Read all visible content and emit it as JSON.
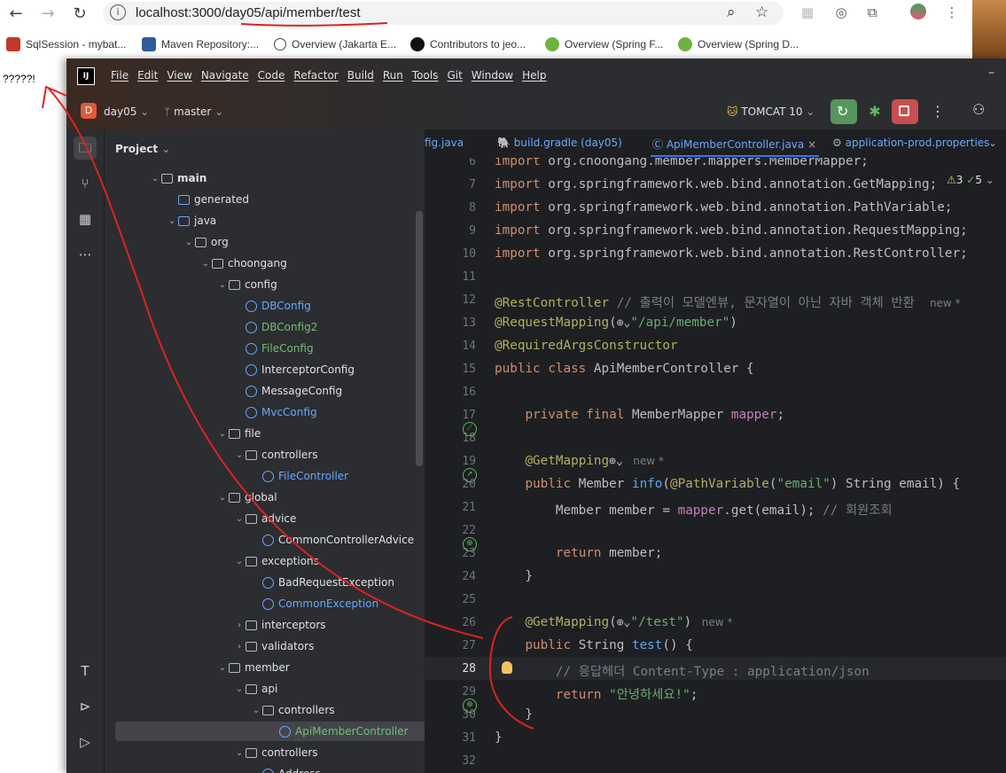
{
  "browser": {
    "url": "localhost:3000/day05/api/member/test",
    "bookmarks": [
      {
        "label": "SqlSession - mybat...",
        "color": "#c0392b"
      },
      {
        "label": "Maven Repository:...",
        "color": "#2e5d9a"
      },
      {
        "label": "Overview (Jakarta E...",
        "color": "#444444"
      },
      {
        "label": "Contributors to jeo...",
        "color": "#111111"
      },
      {
        "label": "Overview (Spring F...",
        "color": "#6db33f"
      },
      {
        "label": "Overview (Spring D...",
        "color": "#6db33f"
      }
    ],
    "page_text": "?????!"
  },
  "ide": {
    "logo": "IJ",
    "menu": [
      "File",
      "Edit",
      "View",
      "Navigate",
      "Code",
      "Refactor",
      "Build",
      "Run",
      "Tools",
      "Git",
      "Window",
      "Help"
    ],
    "project_badge": "D",
    "project_name": "day05",
    "branch": "master",
    "run_config": "TOMCAT 10",
    "project_panel_title": "Project",
    "tabs": [
      "fig.java",
      "build.gradle (day05)",
      "ApiMemberController.java",
      "application-prod.properties"
    ],
    "inspections": {
      "warnings": "3",
      "ok": "5"
    }
  },
  "tree": [
    {
      "label": "main",
      "indent": 0,
      "arrow": "v",
      "icon": "folder",
      "bold": true
    },
    {
      "label": "generated",
      "indent": 1,
      "arrow": "",
      "icon": "folder-blue"
    },
    {
      "label": "java",
      "indent": 1,
      "arrow": "v",
      "icon": "folder-blue"
    },
    {
      "label": "org",
      "indent": 2,
      "arrow": "v",
      "icon": "folder"
    },
    {
      "label": "choongang",
      "indent": 3,
      "arrow": "v",
      "icon": "folder"
    },
    {
      "label": "config",
      "indent": 4,
      "arrow": "v",
      "icon": "folder"
    },
    {
      "label": "DBConfig",
      "indent": 5,
      "arrow": "",
      "icon": "class",
      "color": "blue"
    },
    {
      "label": "DBConfig2",
      "indent": 5,
      "arrow": "",
      "icon": "class",
      "color": "green"
    },
    {
      "label": "FileConfig",
      "indent": 5,
      "arrow": "",
      "icon": "class",
      "color": "green"
    },
    {
      "label": "InterceptorConfig",
      "indent": 5,
      "arrow": "",
      "icon": "class"
    },
    {
      "label": "MessageConfig",
      "indent": 5,
      "arrow": "",
      "icon": "class"
    },
    {
      "label": "MvcConfig",
      "indent": 5,
      "arrow": "",
      "icon": "class",
      "color": "blue"
    },
    {
      "label": "file",
      "indent": 4,
      "arrow": "v",
      "icon": "folder"
    },
    {
      "label": "controllers",
      "indent": 5,
      "arrow": "v",
      "icon": "folder"
    },
    {
      "label": "FileController",
      "indent": 6,
      "arrow": "",
      "icon": "class",
      "color": "blue"
    },
    {
      "label": "global",
      "indent": 4,
      "arrow": "v",
      "icon": "folder"
    },
    {
      "label": "advice",
      "indent": 5,
      "arrow": "v",
      "icon": "folder"
    },
    {
      "label": "CommonControllerAdvice",
      "indent": 6,
      "arrow": "",
      "icon": "class"
    },
    {
      "label": "exceptions",
      "indent": 5,
      "arrow": "v",
      "icon": "folder"
    },
    {
      "label": "BadRequestException",
      "indent": 6,
      "arrow": "",
      "icon": "exception"
    },
    {
      "label": "CommonException",
      "indent": 6,
      "arrow": "",
      "icon": "exception",
      "color": "blue"
    },
    {
      "label": "interceptors",
      "indent": 5,
      "arrow": ">",
      "icon": "folder"
    },
    {
      "label": "validators",
      "indent": 5,
      "arrow": ">",
      "icon": "folder"
    },
    {
      "label": "member",
      "indent": 4,
      "arrow": "v",
      "icon": "folder"
    },
    {
      "label": "api",
      "indent": 5,
      "arrow": "v",
      "icon": "folder"
    },
    {
      "label": "controllers",
      "indent": 6,
      "arrow": "v",
      "icon": "folder"
    },
    {
      "label": "ApiMemberController",
      "indent": 7,
      "arrow": "",
      "icon": "class",
      "color": "green",
      "selected": true
    },
    {
      "label": "controllers",
      "indent": 5,
      "arrow": "v",
      "icon": "folder"
    },
    {
      "label": "Address",
      "indent": 6,
      "arrow": "",
      "icon": "class"
    }
  ],
  "code": [
    {
      "n": "6",
      "segs": [
        [
          "kw",
          "import "
        ],
        [
          "",
          "org.choongang.member.mappers.MemberMapper;"
        ]
      ]
    },
    {
      "n": "7",
      "segs": [
        [
          "kw",
          "import "
        ],
        [
          "",
          "org.springframework.web.bind.annotation.GetMapping;"
        ]
      ]
    },
    {
      "n": "8",
      "segs": [
        [
          "kw",
          "import "
        ],
        [
          "",
          "org.springframework.web.bind.annotation.PathVariable;"
        ]
      ]
    },
    {
      "n": "9",
      "segs": [
        [
          "kw",
          "import "
        ],
        [
          "",
          "org.springframework.web.bind.annotation.RequestMapping;"
        ]
      ]
    },
    {
      "n": "10",
      "segs": [
        [
          "kw",
          "import "
        ],
        [
          "",
          "org.springframework.web.bind.annotation.RestController;"
        ]
      ]
    },
    {
      "n": "11",
      "segs": []
    },
    {
      "n": "12",
      "segs": [
        [
          "an",
          "@RestController "
        ],
        [
          "cm",
          "// 출력이 모델엔뷰, 문자열이 아닌 자바 객체 반환  "
        ],
        [
          "hint",
          "new *"
        ]
      ]
    },
    {
      "n": "13",
      "segs": [
        [
          "an",
          "@RequestMapping"
        ],
        [
          "",
          "("
        ],
        [
          "globe",
          "⊕⌄"
        ],
        [
          "str",
          "\"/api/member\""
        ],
        [
          "",
          ")"
        ]
      ]
    },
    {
      "n": "14",
      "segs": [
        [
          "an",
          "@RequiredArgsConstructor"
        ]
      ]
    },
    {
      "n": "15",
      "segs": [
        [
          "kw",
          "public class "
        ],
        [
          "",
          "ApiMemberController {"
        ]
      ]
    },
    {
      "n": "16",
      "segs": []
    },
    {
      "n": "17",
      "segs": [
        [
          "",
          "    "
        ],
        [
          "kw",
          "private final "
        ],
        [
          "",
          "MemberMapper "
        ],
        [
          "fld",
          "mapper"
        ],
        [
          "",
          ";"
        ]
      ]
    },
    {
      "n": "18",
      "segs": []
    },
    {
      "n": "19",
      "segs": [
        [
          "",
          "    "
        ],
        [
          "an",
          "@GetMapping"
        ],
        [
          "globe",
          "⊕⌄"
        ],
        [
          "hint",
          "   new *"
        ]
      ]
    },
    {
      "n": "20",
      "segs": [
        [
          "",
          "    "
        ],
        [
          "kw",
          "public "
        ],
        [
          "",
          "Member "
        ],
        [
          "fn",
          "info"
        ],
        [
          "",
          "("
        ],
        [
          "an",
          "@PathVariable"
        ],
        [
          "",
          "("
        ],
        [
          "str",
          "\"email\""
        ],
        [
          "",
          ") String email) {"
        ]
      ]
    },
    {
      "n": "21",
      "segs": [
        [
          "",
          "        Member member = "
        ],
        [
          "fld",
          "mapper"
        ],
        [
          "",
          ".get(email); "
        ],
        [
          "cm",
          "// 회원조회"
        ]
      ]
    },
    {
      "n": "22",
      "segs": []
    },
    {
      "n": "23",
      "segs": [
        [
          "",
          "        "
        ],
        [
          "kw",
          "return "
        ],
        [
          "",
          "member;"
        ]
      ]
    },
    {
      "n": "24",
      "segs": [
        [
          "",
          "    }"
        ]
      ]
    },
    {
      "n": "25",
      "segs": []
    },
    {
      "n": "26",
      "segs": [
        [
          "",
          "    "
        ],
        [
          "an",
          "@GetMapping"
        ],
        [
          "",
          "("
        ],
        [
          "globe",
          "⊕⌄"
        ],
        [
          "str",
          "\"/test\""
        ],
        [
          "",
          ")"
        ],
        [
          "hint",
          "   new *"
        ]
      ]
    },
    {
      "n": "27",
      "segs": [
        [
          "",
          "    "
        ],
        [
          "kw",
          "public "
        ],
        [
          "",
          "String "
        ],
        [
          "fn",
          "test"
        ],
        [
          "",
          "() {"
        ]
      ]
    },
    {
      "n": "28",
      "segs": [
        [
          "",
          "        "
        ],
        [
          "cm",
          "// 응답헤더 Content-Type : application/json"
        ]
      ]
    },
    {
      "n": "29",
      "segs": [
        [
          "",
          "        "
        ],
        [
          "kw",
          "return "
        ],
        [
          "str",
          "\"안녕하세요!\""
        ],
        [
          "",
          ";"
        ]
      ]
    },
    {
      "n": "30",
      "segs": [
        [
          "",
          "    }"
        ]
      ]
    },
    {
      "n": "31",
      "segs": [
        [
          "",
          "}"
        ]
      ]
    },
    {
      "n": "32",
      "segs": []
    }
  ]
}
